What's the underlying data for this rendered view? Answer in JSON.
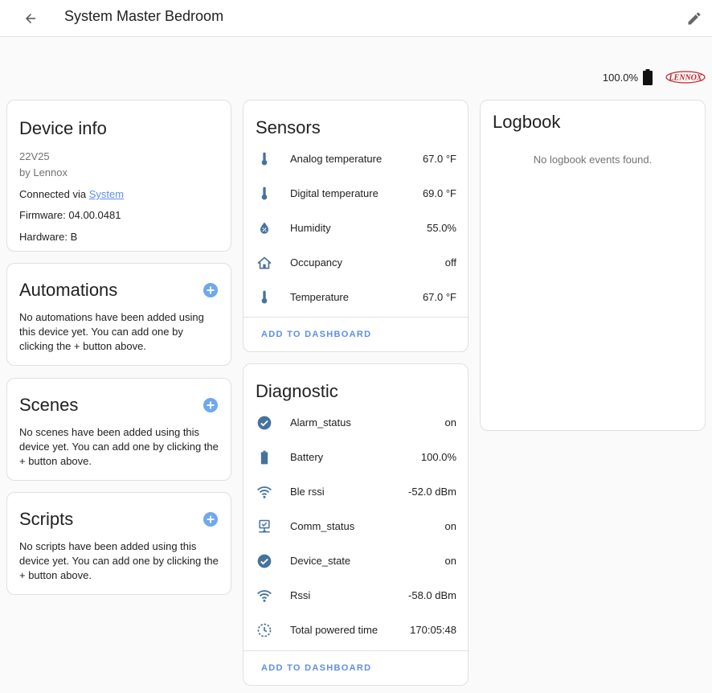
{
  "header": {
    "title": "System Master Bedroom",
    "battery": "100.0%",
    "brand": "LENNOX"
  },
  "device_info": {
    "title": "Device info",
    "model": "22V25",
    "manufacturer": "by Lennox",
    "connected_prefix": "Connected via ",
    "connected_link": "System",
    "firmware": "Firmware: 04.00.0481",
    "hardware": "Hardware: B"
  },
  "automations": {
    "title": "Automations",
    "body": "No automations have been added using this device yet. You can add one by clicking the + button above."
  },
  "scenes": {
    "title": "Scenes",
    "body": "No scenes have been added using this device yet. You can add one by clicking the + button above."
  },
  "scripts": {
    "title": "Scripts",
    "body": "No scripts have been added using this device yet. You can add one by clicking the + button above."
  },
  "sensors": {
    "title": "Sensors",
    "footer": "ADD TO DASHBOARD",
    "items": [
      {
        "icon": "thermometer-icon",
        "name": "Analog temperature",
        "value": "67.0 °F"
      },
      {
        "icon": "thermometer-icon",
        "name": "Digital temperature",
        "value": "69.0 °F"
      },
      {
        "icon": "water-percent-icon",
        "name": "Humidity",
        "value": "55.0%"
      },
      {
        "icon": "home-outline-icon",
        "name": "Occupancy",
        "value": "off"
      },
      {
        "icon": "thermometer-icon",
        "name": "Temperature",
        "value": "67.0 °F"
      }
    ]
  },
  "diagnostic": {
    "title": "Diagnostic",
    "footer": "ADD TO DASHBOARD",
    "items": [
      {
        "icon": "check-circle-icon",
        "name": "Alarm_status",
        "value": "on"
      },
      {
        "icon": "battery-icon",
        "name": "Battery",
        "value": "100.0%"
      },
      {
        "icon": "wifi-icon",
        "name": "Ble rssi",
        "value": "-52.0 dBm"
      },
      {
        "icon": "lan-connect-icon",
        "name": "Comm_status",
        "value": "on"
      },
      {
        "icon": "check-circle-icon",
        "name": "Device_state",
        "value": "on"
      },
      {
        "icon": "wifi-icon",
        "name": "Rssi",
        "value": "-58.0 dBm"
      },
      {
        "icon": "clock-time-icon",
        "name": "Total powered time",
        "value": "170:05:48"
      }
    ]
  },
  "logbook": {
    "title": "Logbook",
    "empty": "No logbook events found."
  },
  "colors": {
    "accent": "#5c8fe6",
    "icon": "#44739e",
    "add_button": "#6fa8ee"
  }
}
